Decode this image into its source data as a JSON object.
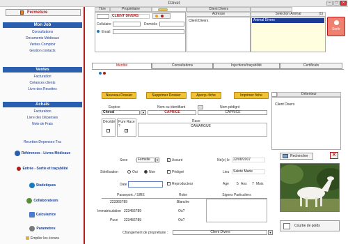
{
  "window": {
    "title": "Dzivet"
  },
  "sidebar": {
    "close_label": "Fermeture",
    "sections": [
      {
        "title": "Mon Job",
        "items": [
          "Consultations",
          "Documents Médicaux",
          "Ventes Comptoir",
          "Gestion contacts"
        ]
      },
      {
        "title": "Ventes",
        "items": [
          "Facturation",
          "Créances clients",
          "Livre des Recettes"
        ]
      },
      {
        "title": "Achats",
        "items": [
          "Facturation",
          "Livre des Dépenses",
          "Note de Frais"
        ]
      }
    ],
    "recettes": "Recettes-Depenses-Tva",
    "references": "Références - Livres Médicaux",
    "entree": "Entrée - Sortie et traçabilité",
    "statistiques": "Statistiques",
    "collaborateurs": "Collaborateurs",
    "calculatrice": "Calculatrice",
    "parametres": "Parametres",
    "empiler": "Empiler les écrans"
  },
  "owner": {
    "titre_label": "Titre",
    "proprietaire_label": "Propriétaire",
    "client_header": "Client Divers",
    "name": "CLIENT DIVERS",
    "adresse_label": "Adresse",
    "address_name": "Client Divers",
    "cellulaire_label": "Cellulaire",
    "domicile_label": "Domicile",
    "email_label": "Email",
    "selection_label": "Selection Animal",
    "selection_count": "(1)",
    "selected_animal": "Animal Divers",
    "sortir_label": "Sortir"
  },
  "tabs": [
    "Identité",
    "Consultations",
    "Injections/traçabilité",
    "Certificats"
  ],
  "actions": {
    "nouveau": "Nouveau Dossier",
    "supprimer": "Supprimer Dossier",
    "apercu": "Aperçu fiche",
    "imprimer": "Imprimer fiche",
    "detenteur": "Détenteur",
    "detenteur_value": "Client Divers"
  },
  "animal": {
    "espece_label": "Espèce",
    "espece": "Cheval",
    "nom_label": "Nom ou identifiant",
    "nom": "CAPRICE",
    "nom_pedigre_label": "Nom pédigré",
    "nom_pedigre": "CAPRICE",
    "decede_label": "Décédé",
    "pure_race_label": "Pure Race ?",
    "race_label": "Race",
    "race": "CAMARGUE",
    "sexe_label": "Sexe",
    "sexe": "Femelle",
    "sterilisation_label": "Stérilisation",
    "oui": "Oui",
    "non": "Non",
    "date_label": "Date",
    "assure_label": "Assuré",
    "pedigre_label": "Pédigré",
    "reproducteur_label": "Reproducteur",
    "ne_label": "Né(e) le",
    "ne_value": "22/08/2007",
    "lieu_label": "Lieu",
    "lieu_value": "Sainte Marie",
    "age_label": "Age",
    "age_ans": "5",
    "ans_label": "Ans",
    "age_mois": "7",
    "mois_label": "Mois",
    "rechercher_label": "Rechercher",
    "passeport_label": "Passeport. / SIRE",
    "passeport_value": "223365789",
    "robe_label": "Robe",
    "robe_value": "Blanche",
    "signes_label": "Signes Particuliers",
    "immat_label": "Immatriculation",
    "immat_value": "223456789",
    "immat_ou": "Où?",
    "puce_label": "Puce",
    "puce_value": "223456789",
    "puce_ou": "Où?",
    "changement_label": "Changement de propriétaire :",
    "changement_value": "Client Divers",
    "courbe_label": "Courbe de poids"
  }
}
